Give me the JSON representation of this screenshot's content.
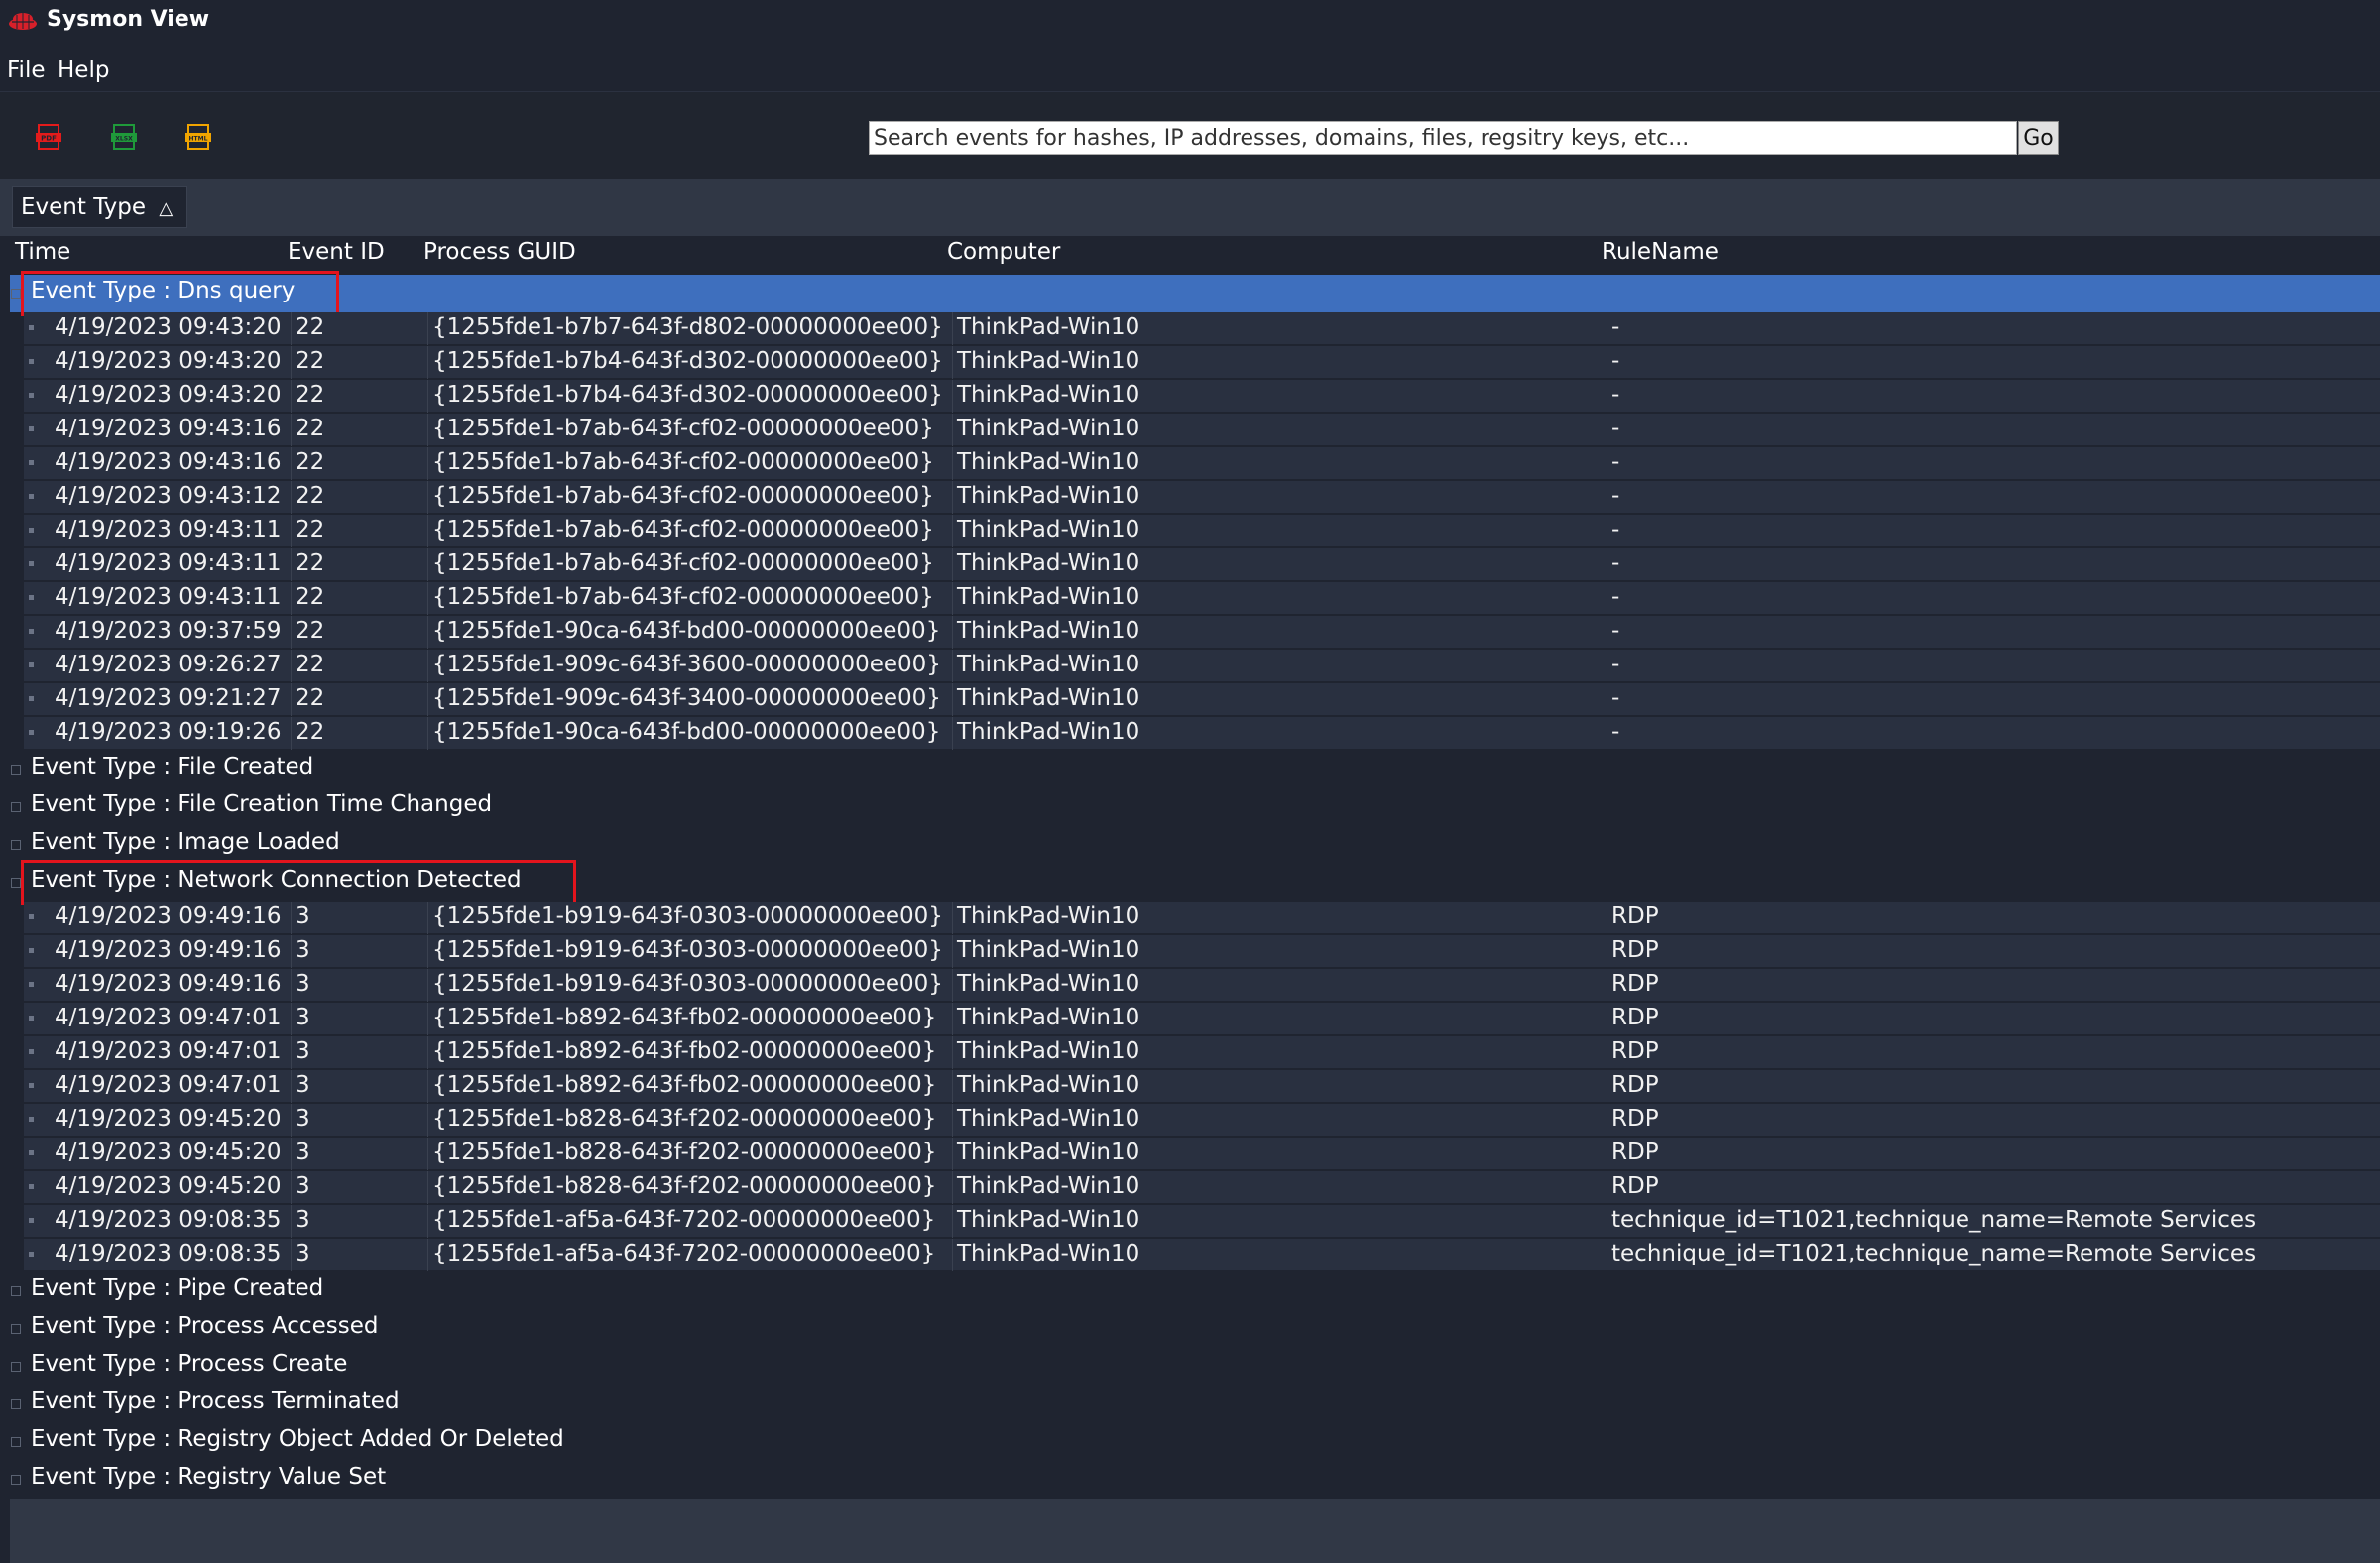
{
  "app": {
    "title": "Sysmon View"
  },
  "menu": [
    "File",
    "Help"
  ],
  "toolbar": {
    "buttons": [
      {
        "label": "PDF",
        "color": "#e31b1b"
      },
      {
        "label": "XLSX",
        "color": "#1f9a3a"
      },
      {
        "label": "HTML",
        "color": "#f0a400"
      }
    ],
    "search_placeholder": "Search events for hashes, IP addresses, domains, files, regsitry keys, etc...",
    "go_label": "Go"
  },
  "group_by": {
    "label": "Event Type",
    "sort_icon": "△"
  },
  "columns": [
    "Time",
    "Event ID",
    "Process GUID",
    "Computer",
    "RuleName"
  ],
  "groups": [
    {
      "label": "Event Type : Dns query",
      "selected": true,
      "highlighted": true,
      "rows": [
        [
          "4/19/2023 09:43:20",
          "22",
          "{1255fde1-b7b7-643f-d802-00000000ee00}",
          "ThinkPad-Win10",
          "-"
        ],
        [
          "4/19/2023 09:43:20",
          "22",
          "{1255fde1-b7b4-643f-d302-00000000ee00}",
          "ThinkPad-Win10",
          "-"
        ],
        [
          "4/19/2023 09:43:20",
          "22",
          "{1255fde1-b7b4-643f-d302-00000000ee00}",
          "ThinkPad-Win10",
          "-"
        ],
        [
          "4/19/2023 09:43:16",
          "22",
          "{1255fde1-b7ab-643f-cf02-00000000ee00}",
          "ThinkPad-Win10",
          "-"
        ],
        [
          "4/19/2023 09:43:16",
          "22",
          "{1255fde1-b7ab-643f-cf02-00000000ee00}",
          "ThinkPad-Win10",
          "-"
        ],
        [
          "4/19/2023 09:43:12",
          "22",
          "{1255fde1-b7ab-643f-cf02-00000000ee00}",
          "ThinkPad-Win10",
          "-"
        ],
        [
          "4/19/2023 09:43:11",
          "22",
          "{1255fde1-b7ab-643f-cf02-00000000ee00}",
          "ThinkPad-Win10",
          "-"
        ],
        [
          "4/19/2023 09:43:11",
          "22",
          "{1255fde1-b7ab-643f-cf02-00000000ee00}",
          "ThinkPad-Win10",
          "-"
        ],
        [
          "4/19/2023 09:43:11",
          "22",
          "{1255fde1-b7ab-643f-cf02-00000000ee00}",
          "ThinkPad-Win10",
          "-"
        ],
        [
          "4/19/2023 09:37:59",
          "22",
          "{1255fde1-90ca-643f-bd00-00000000ee00}",
          "ThinkPad-Win10",
          "-"
        ],
        [
          "4/19/2023 09:26:27",
          "22",
          "{1255fde1-909c-643f-3600-00000000ee00}",
          "ThinkPad-Win10",
          "-"
        ],
        [
          "4/19/2023 09:21:27",
          "22",
          "{1255fde1-909c-643f-3400-00000000ee00}",
          "ThinkPad-Win10",
          "-"
        ],
        [
          "4/19/2023 09:19:26",
          "22",
          "{1255fde1-90ca-643f-bd00-00000000ee00}",
          "ThinkPad-Win10",
          "-"
        ]
      ]
    },
    {
      "label": "Event Type : File Created",
      "rows": []
    },
    {
      "label": "Event Type : File Creation Time Changed",
      "rows": []
    },
    {
      "label": "Event Type : Image Loaded",
      "rows": []
    },
    {
      "label": "Event Type : Network Connection Detected",
      "highlighted": true,
      "rows": [
        [
          "4/19/2023 09:49:16",
          "3",
          "{1255fde1-b919-643f-0303-00000000ee00}",
          "ThinkPad-Win10",
          "RDP"
        ],
        [
          "4/19/2023 09:49:16",
          "3",
          "{1255fde1-b919-643f-0303-00000000ee00}",
          "ThinkPad-Win10",
          "RDP"
        ],
        [
          "4/19/2023 09:49:16",
          "3",
          "{1255fde1-b919-643f-0303-00000000ee00}",
          "ThinkPad-Win10",
          "RDP"
        ],
        [
          "4/19/2023 09:47:01",
          "3",
          "{1255fde1-b892-643f-fb02-00000000ee00}",
          "ThinkPad-Win10",
          "RDP"
        ],
        [
          "4/19/2023 09:47:01",
          "3",
          "{1255fde1-b892-643f-fb02-00000000ee00}",
          "ThinkPad-Win10",
          "RDP"
        ],
        [
          "4/19/2023 09:47:01",
          "3",
          "{1255fde1-b892-643f-fb02-00000000ee00}",
          "ThinkPad-Win10",
          "RDP"
        ],
        [
          "4/19/2023 09:45:20",
          "3",
          "{1255fde1-b828-643f-f202-00000000ee00}",
          "ThinkPad-Win10",
          "RDP"
        ],
        [
          "4/19/2023 09:45:20",
          "3",
          "{1255fde1-b828-643f-f202-00000000ee00}",
          "ThinkPad-Win10",
          "RDP"
        ],
        [
          "4/19/2023 09:45:20",
          "3",
          "{1255fde1-b828-643f-f202-00000000ee00}",
          "ThinkPad-Win10",
          "RDP"
        ],
        [
          "4/19/2023 09:08:35",
          "3",
          "{1255fde1-af5a-643f-7202-00000000ee00}",
          "ThinkPad-Win10",
          "technique_id=T1021,technique_name=Remote Services"
        ],
        [
          "4/19/2023 09:08:35",
          "3",
          "{1255fde1-af5a-643f-7202-00000000ee00}",
          "ThinkPad-Win10",
          "technique_id=T1021,technique_name=Remote Services"
        ]
      ]
    },
    {
      "label": "Event Type : Pipe Created",
      "rows": []
    },
    {
      "label": "Event Type : Process Accessed",
      "rows": []
    },
    {
      "label": "Event Type : Process Create",
      "rows": []
    },
    {
      "label": "Event Type : Process Terminated",
      "rows": []
    },
    {
      "label": "Event Type : Registry Object Added Or Deleted",
      "rows": []
    },
    {
      "label": "Event Type : Registry Value Set",
      "rows": []
    }
  ],
  "colors": {
    "selection": "#3e6fbe",
    "highlight_box": "#e3141d",
    "logo": "#d8202a"
  }
}
